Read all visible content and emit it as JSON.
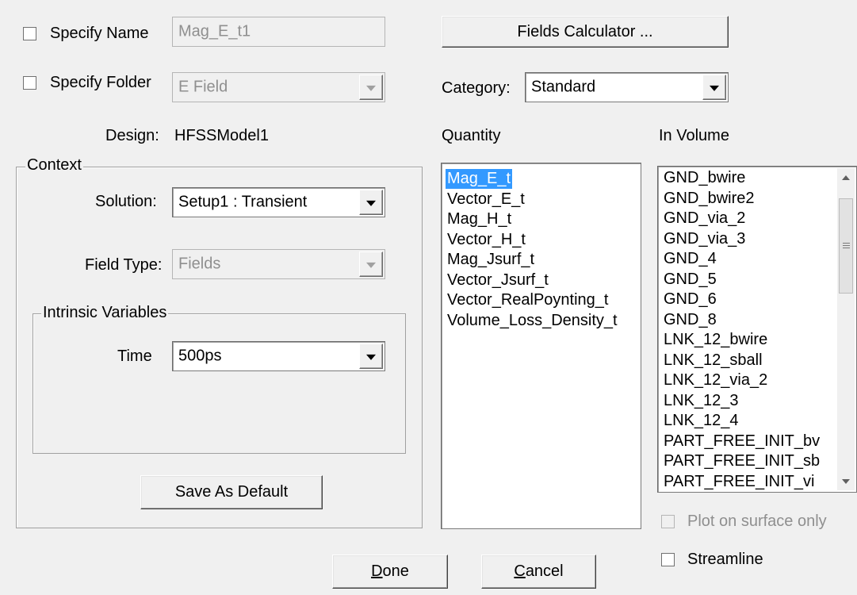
{
  "name_row": {
    "checkbox_label": "Specify Name",
    "name_value": "Mag_E_t1"
  },
  "folder_row": {
    "checkbox_label": "Specify Folder",
    "folder_value": "E Field"
  },
  "fields_calculator_label": "Fields Calculator ...",
  "category": {
    "label": "Category:",
    "value": "Standard"
  },
  "design": {
    "label": "Design:",
    "value": "HFSSModel1"
  },
  "context": {
    "legend": "Context",
    "solution_label": "Solution:",
    "solution_value": "Setup1 : Transient",
    "field_type_label": "Field Type:",
    "field_type_value": "Fields",
    "intrinsic": {
      "legend": "Intrinsic Variables",
      "time_label": "Time",
      "time_value": "500ps"
    },
    "save_default_label": "Save As Default"
  },
  "quantity": {
    "header": "Quantity",
    "selected_index": 0,
    "items": [
      "Mag_E_t",
      "Vector_E_t",
      "Mag_H_t",
      "Vector_H_t",
      "Mag_Jsurf_t",
      "Vector_Jsurf_t",
      "Vector_RealPoynting_t",
      "Volume_Loss_Density_t"
    ]
  },
  "in_volume": {
    "header": "In Volume",
    "items": [
      "GND_bwire",
      "GND_bwire2",
      "GND_via_2",
      "GND_via_3",
      "GND_4",
      "GND_5",
      "GND_6",
      "GND_8",
      "LNK_12_bwire",
      "LNK_12_sball",
      "LNK_12_via_2",
      "LNK_12_3",
      "LNK_12_4",
      "PART_FREE_INIT_bv",
      "PART_FREE_INIT_sb",
      "PART_FREE_INIT_vi"
    ]
  },
  "plot_on_surface_label": "Plot on surface only",
  "streamline_label": "Streamline",
  "buttons": {
    "done_mnemonic": "D",
    "done_rest": "one",
    "cancel_mnemonic": "C",
    "cancel_rest": "ancel"
  },
  "colors": {
    "dialog_bg": "#f0f0f0",
    "selection": "#3399ff",
    "disabled_text": "#8f8f8f"
  }
}
